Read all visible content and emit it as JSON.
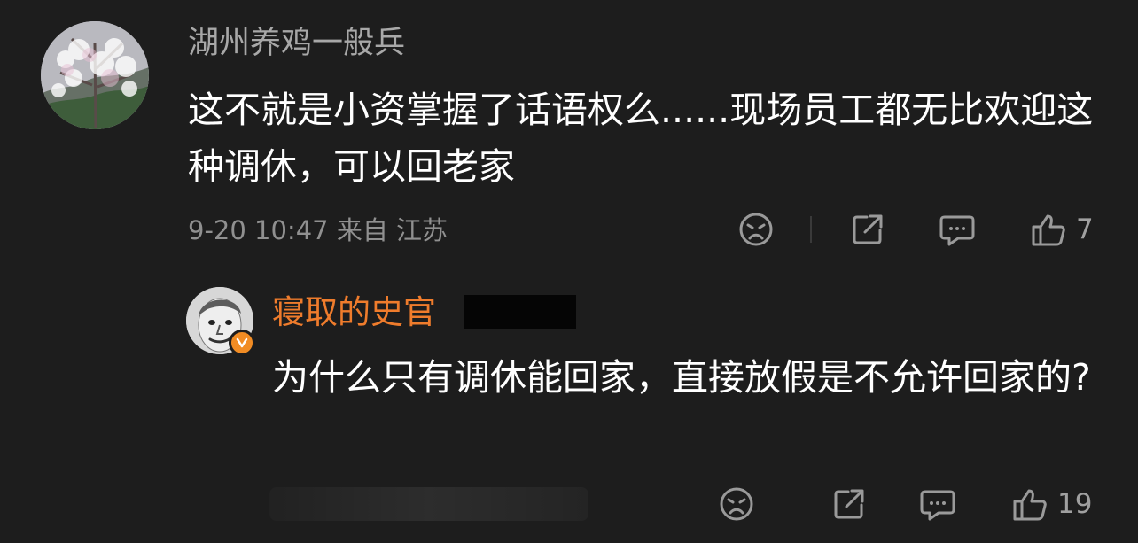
{
  "comment": {
    "username": "湖州养鸡一般兵",
    "text": "这不就是小资掌握了话语权么......现场员工都无比欢迎这种调休，可以回老家",
    "date": "9-20 10:47",
    "location": "来自 江苏",
    "likes": "7",
    "icons": {
      "emoji": "sad-face-icon",
      "share": "share-icon",
      "comment": "comment-icon",
      "like": "thumbs-up-icon"
    }
  },
  "reply": {
    "username": "寝取的史官",
    "text": "为什么只有调休能回家，直接放假是不允许回家的?",
    "likes": "19",
    "verified_color": "#f18c24",
    "icons": {
      "emoji": "sad-face-icon",
      "share": "share-icon",
      "comment": "comment-icon",
      "like": "thumbs-up-icon"
    }
  },
  "colors": {
    "background": "#1d1d1d",
    "primary_text": "#ffffff",
    "secondary_text": "#a8a8a8",
    "reply_name": "#ef7c2c"
  }
}
